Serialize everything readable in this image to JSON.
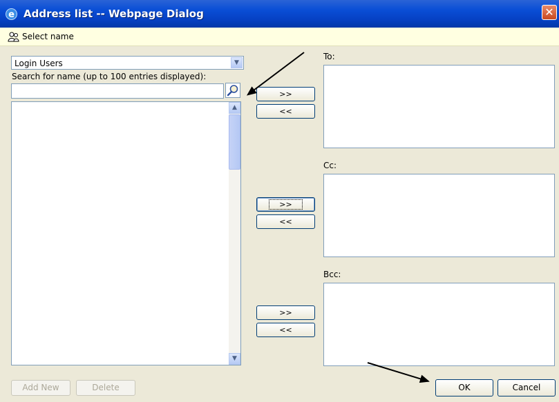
{
  "window": {
    "title": "Address list -- Webpage Dialog",
    "close_glyph": "✕"
  },
  "header": {
    "label": "Select name"
  },
  "directory": {
    "selected": "Login Users"
  },
  "search": {
    "label": "Search for name (up to 100 entries displayed):",
    "value": "",
    "placeholder": ""
  },
  "transfer": {
    "add": ">>",
    "remove": "<<"
  },
  "fields": {
    "to": "To:",
    "cc": "Cc:",
    "bcc": "Bcc:"
  },
  "buttons": {
    "add_new": "Add New",
    "delete": "Delete",
    "ok": "OK",
    "cancel": "Cancel"
  },
  "icons": {
    "window": "ie-icon",
    "header": "people-icon",
    "search": "magnifier-icon",
    "dropdown": "chevron-down-icon"
  },
  "colors": {
    "titlebar": "#0a4fd6",
    "dialog_bg": "#ece9d8",
    "info_bar": "#ffffe1",
    "field_border": "#7f9db9"
  }
}
